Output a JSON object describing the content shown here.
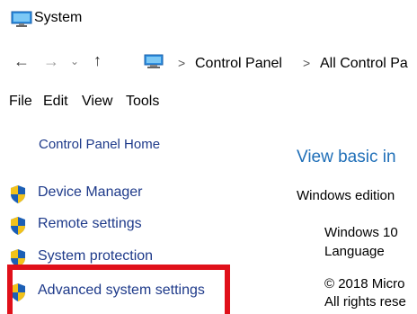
{
  "window": {
    "title": "System",
    "icon": "system-monitor-icon"
  },
  "navigation": {
    "back_icon": "arrow-left-icon",
    "forward_icon": "arrow-right-icon",
    "recent_icon": "chevron-down-icon",
    "up_icon": "arrow-up-icon",
    "address": {
      "icon": "control-panel-icon",
      "separator": ">",
      "crumbs": [
        "Control Panel",
        "All Control Pa"
      ]
    }
  },
  "menu": {
    "items": [
      "File",
      "Edit",
      "View",
      "Tools"
    ]
  },
  "sidebar": {
    "home_link": "Control Panel Home",
    "links": [
      {
        "label": "Device Manager",
        "icon": "uac-shield-icon"
      },
      {
        "label": "Remote settings",
        "icon": "uac-shield-icon"
      },
      {
        "label": "System protection",
        "icon": "uac-shield-icon"
      },
      {
        "label": "Advanced system settings",
        "icon": "uac-shield-icon"
      }
    ]
  },
  "main": {
    "heading": "View basic in",
    "edition_section": "Windows edition",
    "edition_name": "Windows 10",
    "edition_sub": "Language",
    "copyright": "© 2018 Micro",
    "rights": "All rights rese"
  },
  "colors": {
    "link": "#1e3a8a",
    "heading": "#1f6fb8",
    "highlight": "#e0101a",
    "shield_blue": "#1c5fb5",
    "shield_yellow": "#f2c21a"
  }
}
